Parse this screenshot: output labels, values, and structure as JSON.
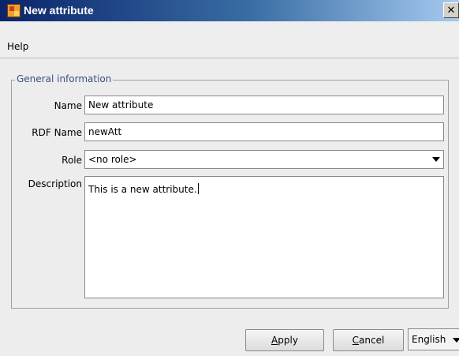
{
  "window": {
    "title": "New attribute",
    "close_glyph": "✕"
  },
  "menu": {
    "items": [
      {
        "label": "Help"
      }
    ]
  },
  "general": {
    "legend": "General information",
    "name": {
      "label": "Name",
      "value": "New attribute"
    },
    "rdf_name": {
      "label": "RDF Name",
      "value": "newAtt"
    },
    "role": {
      "label": "Role",
      "value": "<no role>"
    },
    "description": {
      "label": "Description",
      "value": "This is a new attribute."
    }
  },
  "buttons": {
    "apply": {
      "mnemonic": "A",
      "rest": "pply"
    },
    "cancel": {
      "mnemonic": "C",
      "rest": "ancel"
    }
  },
  "language": {
    "value": "English"
  },
  "colors": {
    "title_start": "#0a246a",
    "title_end": "#a6caf0",
    "legend_text": "#3a4f88"
  }
}
